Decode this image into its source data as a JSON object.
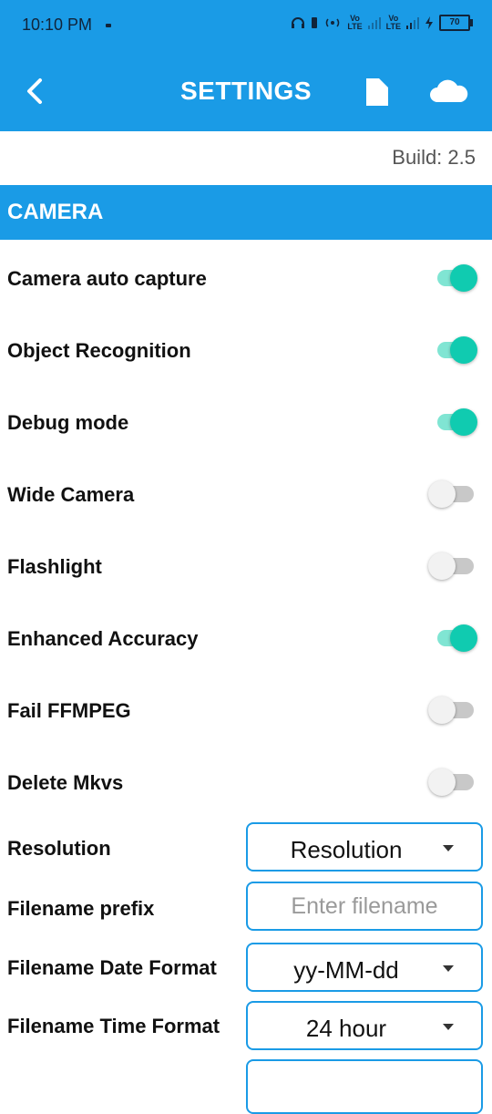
{
  "status_bar": {
    "time": "10:10 PM",
    "lte1": "Vo\nLTE",
    "lte2": "Vo\nLTE",
    "battery": "70"
  },
  "app_bar": {
    "title": "SETTINGS",
    "icons": [
      "back-arrow-icon",
      "file-icon",
      "cloud-icon"
    ]
  },
  "build_label": "Build: 2.5",
  "section": {
    "title": "CAMERA"
  },
  "toggles": [
    {
      "label": "Camera auto capture",
      "on": true
    },
    {
      "label": "Object Recognition",
      "on": true
    },
    {
      "label": "Debug mode",
      "on": true
    },
    {
      "label": "Wide Camera",
      "on": false
    },
    {
      "label": "Flashlight",
      "on": false
    },
    {
      "label": "Enhanced Accuracy",
      "on": true
    },
    {
      "label": "Fail FFMPEG",
      "on": false
    },
    {
      "label": "Delete Mkvs",
      "on": false
    }
  ],
  "fields": {
    "resolution": {
      "label": "Resolution",
      "value": "Resolution"
    },
    "filename_prefix": {
      "label": "Filename prefix",
      "value": "",
      "placeholder": "Enter filename"
    },
    "date_format": {
      "label": "Filename Date Format",
      "value": "yy-MM-dd"
    },
    "time_format": {
      "label": "Filename Time Format",
      "value": "24 hour"
    }
  },
  "colors": {
    "primary": "#1a9be6",
    "toggle_on": "#10cbb0",
    "toggle_on_track": "#80e5d3",
    "toggle_off": "#c8c8c8"
  }
}
